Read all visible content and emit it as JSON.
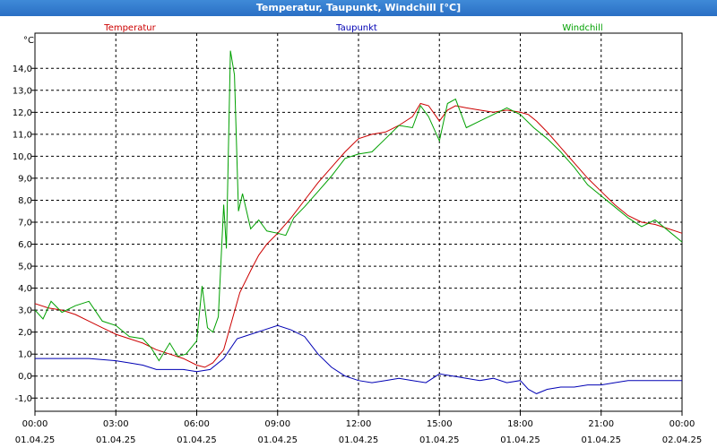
{
  "window": {
    "title": "Temperatur, Taupunkt, Windchill [°C]"
  },
  "chart_data": {
    "type": "line",
    "title": "Temperatur, Taupunkt, Windchill [°C]",
    "ylabel": "°C",
    "xlabel": "",
    "grid": true,
    "legend_position": "top",
    "ylim": [
      -1.6,
      15.6
    ],
    "yticks": [
      "-1,0",
      "0,0",
      "1,0",
      "2,0",
      "3,0",
      "4,0",
      "5,0",
      "6,0",
      "7,0",
      "8,0",
      "9,0",
      "10,0",
      "11,0",
      "12,0",
      "13,0",
      "14,0"
    ],
    "xlim": [
      0,
      24
    ],
    "xticks": [
      {
        "hour": 0,
        "time": "00:00",
        "date": "01.04.25"
      },
      {
        "hour": 3,
        "time": "03:00",
        "date": "01.04.25"
      },
      {
        "hour": 6,
        "time": "06:00",
        "date": "01.04.25"
      },
      {
        "hour": 9,
        "time": "09:00",
        "date": "01.04.25"
      },
      {
        "hour": 12,
        "time": "12:00",
        "date": "01.04.25"
      },
      {
        "hour": 15,
        "time": "15:00",
        "date": "01.04.25"
      },
      {
        "hour": 18,
        "time": "18:00",
        "date": "01.04.25"
      },
      {
        "hour": 21,
        "time": "21:00",
        "date": "01.04.25"
      },
      {
        "hour": 24,
        "time": "00:00",
        "date": "02.04.25"
      }
    ],
    "series": [
      {
        "name": "Temperatur",
        "color": "#cc0000",
        "points": [
          [
            0,
            3.3
          ],
          [
            0.5,
            3.1
          ],
          [
            1,
            3.0
          ],
          [
            1.5,
            2.8
          ],
          [
            2,
            2.5
          ],
          [
            2.5,
            2.2
          ],
          [
            3,
            1.9
          ],
          [
            3.5,
            1.7
          ],
          [
            4,
            1.5
          ],
          [
            4.5,
            1.2
          ],
          [
            5,
            1.0
          ],
          [
            5.5,
            0.8
          ],
          [
            6,
            0.5
          ],
          [
            6.3,
            0.4
          ],
          [
            6.6,
            0.6
          ],
          [
            7,
            1.2
          ],
          [
            7.3,
            2.5
          ],
          [
            7.6,
            3.8
          ],
          [
            8,
            4.8
          ],
          [
            8.3,
            5.5
          ],
          [
            8.6,
            6.0
          ],
          [
            9,
            6.5
          ],
          [
            9.5,
            7.2
          ],
          [
            10,
            8.0
          ],
          [
            10.5,
            8.8
          ],
          [
            11,
            9.5
          ],
          [
            11.5,
            10.2
          ],
          [
            12,
            10.8
          ],
          [
            12.5,
            11.0
          ],
          [
            13,
            11.1
          ],
          [
            13.5,
            11.4
          ],
          [
            14,
            11.8
          ],
          [
            14.3,
            12.4
          ],
          [
            14.6,
            12.3
          ],
          [
            15,
            11.6
          ],
          [
            15.3,
            12.1
          ],
          [
            15.6,
            12.3
          ],
          [
            16,
            12.2
          ],
          [
            16.5,
            12.1
          ],
          [
            17,
            12.0
          ],
          [
            17.5,
            12.1
          ],
          [
            18,
            12.0
          ],
          [
            18.3,
            11.9
          ],
          [
            18.6,
            11.6
          ],
          [
            19,
            11.1
          ],
          [
            19.5,
            10.4
          ],
          [
            20,
            9.7
          ],
          [
            20.5,
            9.0
          ],
          [
            21,
            8.4
          ],
          [
            21.5,
            7.8
          ],
          [
            22,
            7.3
          ],
          [
            22.5,
            7.0
          ],
          [
            23,
            6.9
          ],
          [
            23.5,
            6.7
          ],
          [
            24,
            6.5
          ]
        ]
      },
      {
        "name": "Taupunkt",
        "color": "#0000b4",
        "points": [
          [
            0,
            0.8
          ],
          [
            1,
            0.8
          ],
          [
            2,
            0.8
          ],
          [
            3,
            0.7
          ],
          [
            3.5,
            0.6
          ],
          [
            4,
            0.5
          ],
          [
            4.5,
            0.3
          ],
          [
            5,
            0.3
          ],
          [
            5.5,
            0.3
          ],
          [
            6,
            0.2
          ],
          [
            6.5,
            0.3
          ],
          [
            7,
            0.8
          ],
          [
            7.5,
            1.7
          ],
          [
            8,
            1.9
          ],
          [
            8.5,
            2.1
          ],
          [
            9,
            2.3
          ],
          [
            9.5,
            2.1
          ],
          [
            10,
            1.8
          ],
          [
            10.5,
            1.0
          ],
          [
            11,
            0.4
          ],
          [
            11.5,
            0.0
          ],
          [
            12,
            -0.2
          ],
          [
            12.5,
            -0.3
          ],
          [
            13,
            -0.2
          ],
          [
            13.5,
            -0.1
          ],
          [
            14,
            -0.2
          ],
          [
            14.5,
            -0.3
          ],
          [
            15,
            0.1
          ],
          [
            15.5,
            0.0
          ],
          [
            16,
            -0.1
          ],
          [
            16.5,
            -0.2
          ],
          [
            17,
            -0.1
          ],
          [
            17.5,
            -0.3
          ],
          [
            18,
            -0.2
          ],
          [
            18.3,
            -0.6
          ],
          [
            18.6,
            -0.8
          ],
          [
            19,
            -0.6
          ],
          [
            19.5,
            -0.5
          ],
          [
            20,
            -0.5
          ],
          [
            20.5,
            -0.4
          ],
          [
            21,
            -0.4
          ],
          [
            21.5,
            -0.3
          ],
          [
            22,
            -0.2
          ],
          [
            22.5,
            -0.2
          ],
          [
            23,
            -0.2
          ],
          [
            24,
            -0.2
          ]
        ]
      },
      {
        "name": "Windchill",
        "color": "#00a000",
        "points": [
          [
            0,
            3.0
          ],
          [
            0.3,
            2.6
          ],
          [
            0.6,
            3.4
          ],
          [
            1,
            2.9
          ],
          [
            1.5,
            3.2
          ],
          [
            2,
            3.4
          ],
          [
            2.5,
            2.5
          ],
          [
            3,
            2.3
          ],
          [
            3.5,
            1.8
          ],
          [
            4,
            1.7
          ],
          [
            4.3,
            1.3
          ],
          [
            4.6,
            0.7
          ],
          [
            5,
            1.5
          ],
          [
            5.3,
            0.9
          ],
          [
            5.6,
            1.0
          ],
          [
            6,
            1.6
          ],
          [
            6.2,
            4.1
          ],
          [
            6.4,
            2.2
          ],
          [
            6.6,
            2.0
          ],
          [
            6.8,
            2.7
          ],
          [
            7,
            7.8
          ],
          [
            7.1,
            5.8
          ],
          [
            7.25,
            14.8
          ],
          [
            7.4,
            13.7
          ],
          [
            7.55,
            7.5
          ],
          [
            7.7,
            8.3
          ],
          [
            8,
            6.7
          ],
          [
            8.3,
            7.1
          ],
          [
            8.6,
            6.6
          ],
          [
            9,
            6.5
          ],
          [
            9.3,
            6.4
          ],
          [
            9.6,
            7.2
          ],
          [
            10,
            7.7
          ],
          [
            10.5,
            8.4
          ],
          [
            11,
            9.1
          ],
          [
            11.5,
            9.9
          ],
          [
            12,
            10.1
          ],
          [
            12.5,
            10.2
          ],
          [
            13,
            10.8
          ],
          [
            13.5,
            11.4
          ],
          [
            14,
            11.3
          ],
          [
            14.3,
            12.3
          ],
          [
            14.6,
            11.8
          ],
          [
            15,
            10.7
          ],
          [
            15.3,
            12.4
          ],
          [
            15.6,
            12.6
          ],
          [
            16,
            11.3
          ],
          [
            16.5,
            11.6
          ],
          [
            17,
            11.9
          ],
          [
            17.5,
            12.2
          ],
          [
            18,
            11.9
          ],
          [
            18.5,
            11.3
          ],
          [
            19,
            10.8
          ],
          [
            19.5,
            10.2
          ],
          [
            20,
            9.5
          ],
          [
            20.5,
            8.7
          ],
          [
            21,
            8.2
          ],
          [
            21.5,
            7.7
          ],
          [
            22,
            7.2
          ],
          [
            22.5,
            6.8
          ],
          [
            23,
            7.1
          ],
          [
            23.5,
            6.6
          ],
          [
            24,
            6.1
          ]
        ]
      }
    ]
  }
}
